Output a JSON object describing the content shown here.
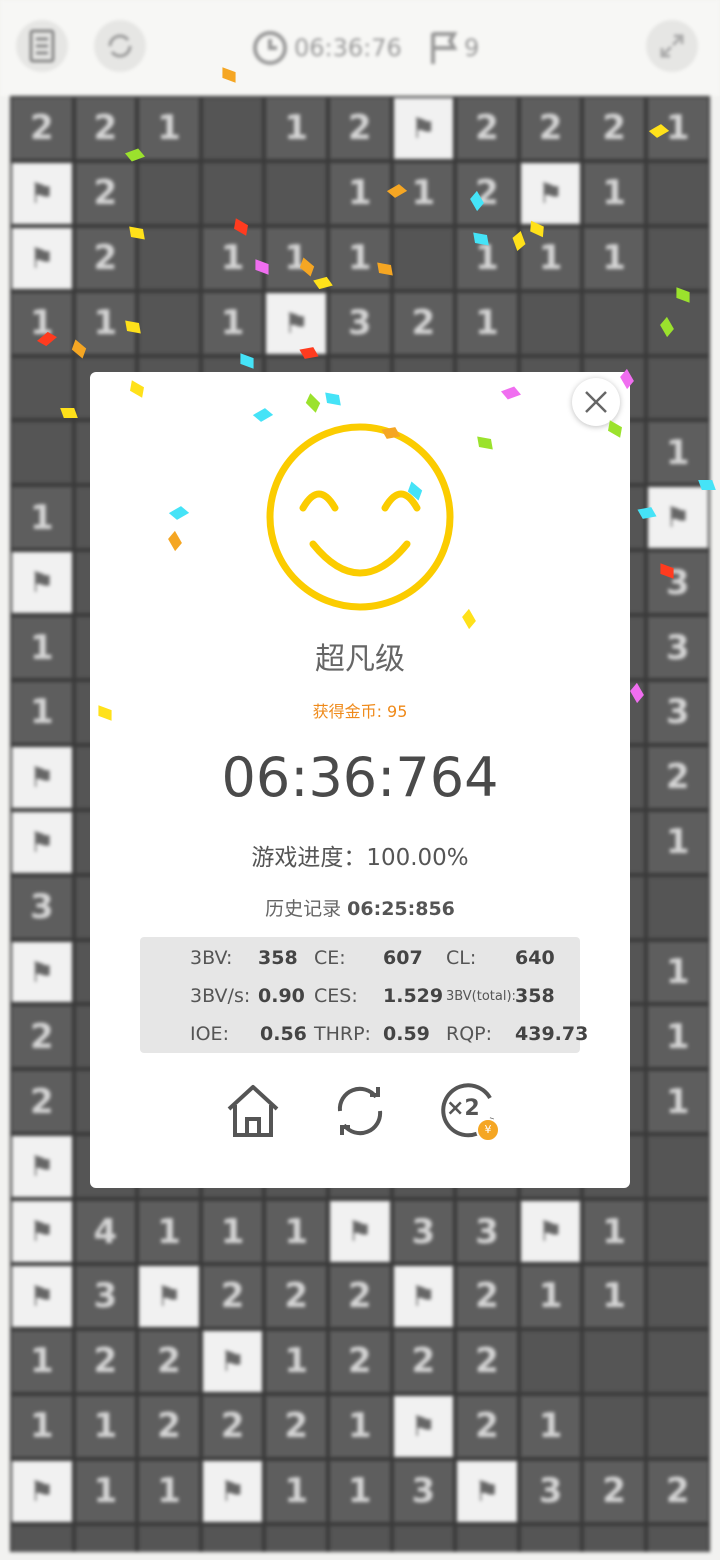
{
  "topbar": {
    "timer": "06:36:76",
    "flags": "9"
  },
  "board": {
    "rows": [
      [
        "2",
        "2",
        "1",
        "",
        "1",
        "2",
        "F",
        "2",
        "2",
        "2",
        "1"
      ],
      [
        "F",
        "2",
        "",
        "",
        "",
        "1",
        "1",
        "2",
        "F",
        "1",
        ""
      ],
      [
        "F",
        "2",
        "",
        "1",
        "1",
        "1",
        "",
        "1",
        "1",
        "1",
        ""
      ],
      [
        "1",
        "1",
        "",
        "1",
        "F",
        "3",
        "2",
        "1",
        "",
        "",
        ""
      ],
      [
        "",
        "",
        "",
        "",
        "",
        "",
        "",
        "",
        "",
        "",
        ""
      ],
      [
        "",
        "",
        "",
        "",
        "",
        "",
        "",
        "",
        "",
        "",
        "1"
      ],
      [
        "1",
        "",
        "",
        "",
        "",
        "",
        "",
        "",
        "",
        "",
        "F"
      ],
      [
        "F",
        "",
        "",
        "",
        "",
        "",
        "",
        "",
        "",
        "",
        "3"
      ],
      [
        "1",
        "",
        "",
        "",
        "",
        "",
        "",
        "",
        "",
        "",
        "3"
      ],
      [
        "1",
        "",
        "",
        "",
        "",
        "",
        "",
        "",
        "",
        "",
        "3"
      ],
      [
        "F",
        "",
        "",
        "",
        "",
        "",
        "",
        "",
        "",
        "",
        "2"
      ],
      [
        "F",
        "",
        "",
        "",
        "",
        "",
        "",
        "",
        "",
        "",
        "1"
      ],
      [
        "3",
        "",
        "",
        "",
        "",
        "",
        "",
        "",
        "",
        "",
        ""
      ],
      [
        "F",
        "",
        "",
        "",
        "",
        "",
        "",
        "",
        "",
        "",
        "1"
      ],
      [
        "2",
        "",
        "",
        "",
        "",
        "",
        "",
        "",
        "",
        "",
        "1"
      ],
      [
        "2",
        "",
        "",
        "",
        "",
        "",
        "",
        "",
        "",
        "",
        "1"
      ],
      [
        "F",
        "",
        "",
        "",
        "",
        "",
        "",
        "",
        "",
        "",
        ""
      ],
      [
        "F",
        "4",
        "1",
        "1",
        "1",
        "F",
        "3",
        "3",
        "F",
        "1",
        ""
      ],
      [
        "F",
        "3",
        "F",
        "2",
        "2",
        "2",
        "F",
        "2",
        "1",
        "1",
        ""
      ],
      [
        "1",
        "2",
        "2",
        "F",
        "1",
        "2",
        "2",
        "2",
        "",
        "",
        ""
      ],
      [
        "1",
        "1",
        "2",
        "2",
        "2",
        "1",
        "F",
        "2",
        "1",
        "",
        ""
      ],
      [
        "F",
        "1",
        "1",
        "F",
        "1",
        "1",
        "3",
        "F",
        "3",
        "2",
        "2"
      ],
      [
        "",
        "",
        "",
        "",
        "",
        "",
        "",
        "",
        "",
        "",
        ""
      ]
    ]
  },
  "dialog": {
    "level": "超凡级",
    "coins": "获得金币: 95",
    "time": "06:36:764",
    "progress": "游戏进度：100.00%",
    "history_label": "历史记录",
    "history_value": "06:25:856",
    "stats": {
      "bbbv_label": "3BV:",
      "bbbv": "358",
      "ce_label": "CE:",
      "ce": "607",
      "cl_label": "CL:",
      "cl": "640",
      "bbbvs_label": "3BV/s:",
      "bbbvs": "0.90",
      "ces_label": "CES:",
      "ces": "1.529",
      "bbbv_total_label": "3BV(total):",
      "bbbv_total": "358",
      "ioe_label": "IOE:",
      "ioe": "0.56",
      "thrp_label": "THRP:",
      "thrp": "0.59",
      "rqp_label": "RQP:",
      "rqp": "439.73"
    },
    "double_label": "×2",
    "coin_symbol": "¥"
  },
  "colors": {
    "smiley": "#fbcc00",
    "coin_text": "#ef8a1a",
    "coin_badge": "#f5a623"
  }
}
